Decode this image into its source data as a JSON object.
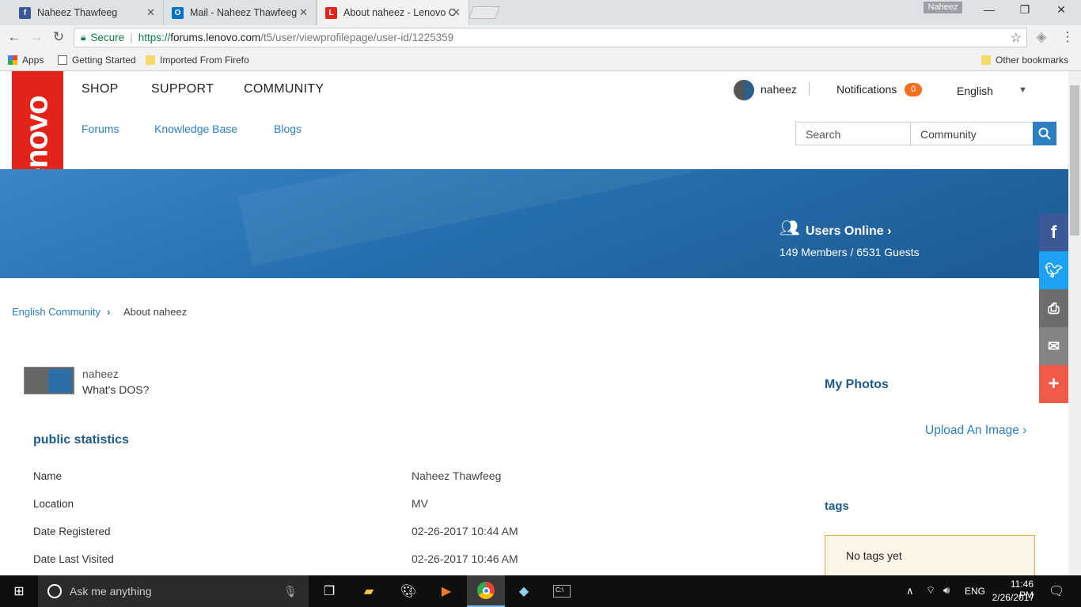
{
  "browser": {
    "tabs": [
      {
        "title": "Naheez Thawfeeg",
        "icon": "facebook-icon"
      },
      {
        "title": "Mail - Naheez Thawfeeg",
        "icon": "outlook-icon"
      },
      {
        "title": "About naheez - Lenovo C",
        "icon": "lenovo-icon"
      }
    ],
    "window_user": "Naheez",
    "secure_label": "Secure",
    "url_scheme": "https://",
    "url_host": "forums.lenovo.com",
    "url_path": "/t5/user/viewprofilepage/user-id/1225359",
    "bookmarks": [
      "Apps",
      "Getting Started",
      "Imported From Firefo"
    ],
    "other_bookmarks": "Other bookmarks"
  },
  "site": {
    "logo_text": "Lenovo",
    "main_nav": [
      "SHOP",
      "SUPPORT",
      "COMMUNITY"
    ],
    "sub_nav": [
      "Forums",
      "Knowledge Base",
      "Blogs"
    ],
    "username": "naheez",
    "notifications_label": "Notifications",
    "notifications_count": "0",
    "language": "English",
    "search_placeholder": "Search",
    "search_scope": "Community"
  },
  "banner": {
    "users_online_title": "Users Online",
    "users_online_stats": "149 Members / 6531 Guests"
  },
  "breadcrumb": {
    "parent": "English Community",
    "current": "About naheez"
  },
  "profile": {
    "name": "naheez",
    "rank": "What's DOS?",
    "section_title": "public statistics",
    "stats": [
      {
        "label": "Name",
        "value": "Naheez Thawfeeg"
      },
      {
        "label": "Location",
        "value": "MV"
      },
      {
        "label": "Date Registered",
        "value": "02-26-2017 10:44 AM"
      },
      {
        "label": "Date Last Visited",
        "value": "02-26-2017 10:46 AM"
      }
    ]
  },
  "sidebar": {
    "photos_title": "My Photos",
    "upload_label": "Upload An Image",
    "tags_title": "tags",
    "no_tags": "No tags yet"
  },
  "social": [
    {
      "name": "facebook",
      "color": "#3b5998"
    },
    {
      "name": "twitter",
      "color": "#1da1f2"
    },
    {
      "name": "print",
      "color": "#6d6d6d"
    },
    {
      "name": "email",
      "color": "#848484"
    },
    {
      "name": "share",
      "color": "#f05a48"
    }
  ],
  "taskbar": {
    "search_placeholder": "Ask me anything",
    "lang": "ENG",
    "time": "11:46 PM",
    "date": "2/26/2017"
  }
}
